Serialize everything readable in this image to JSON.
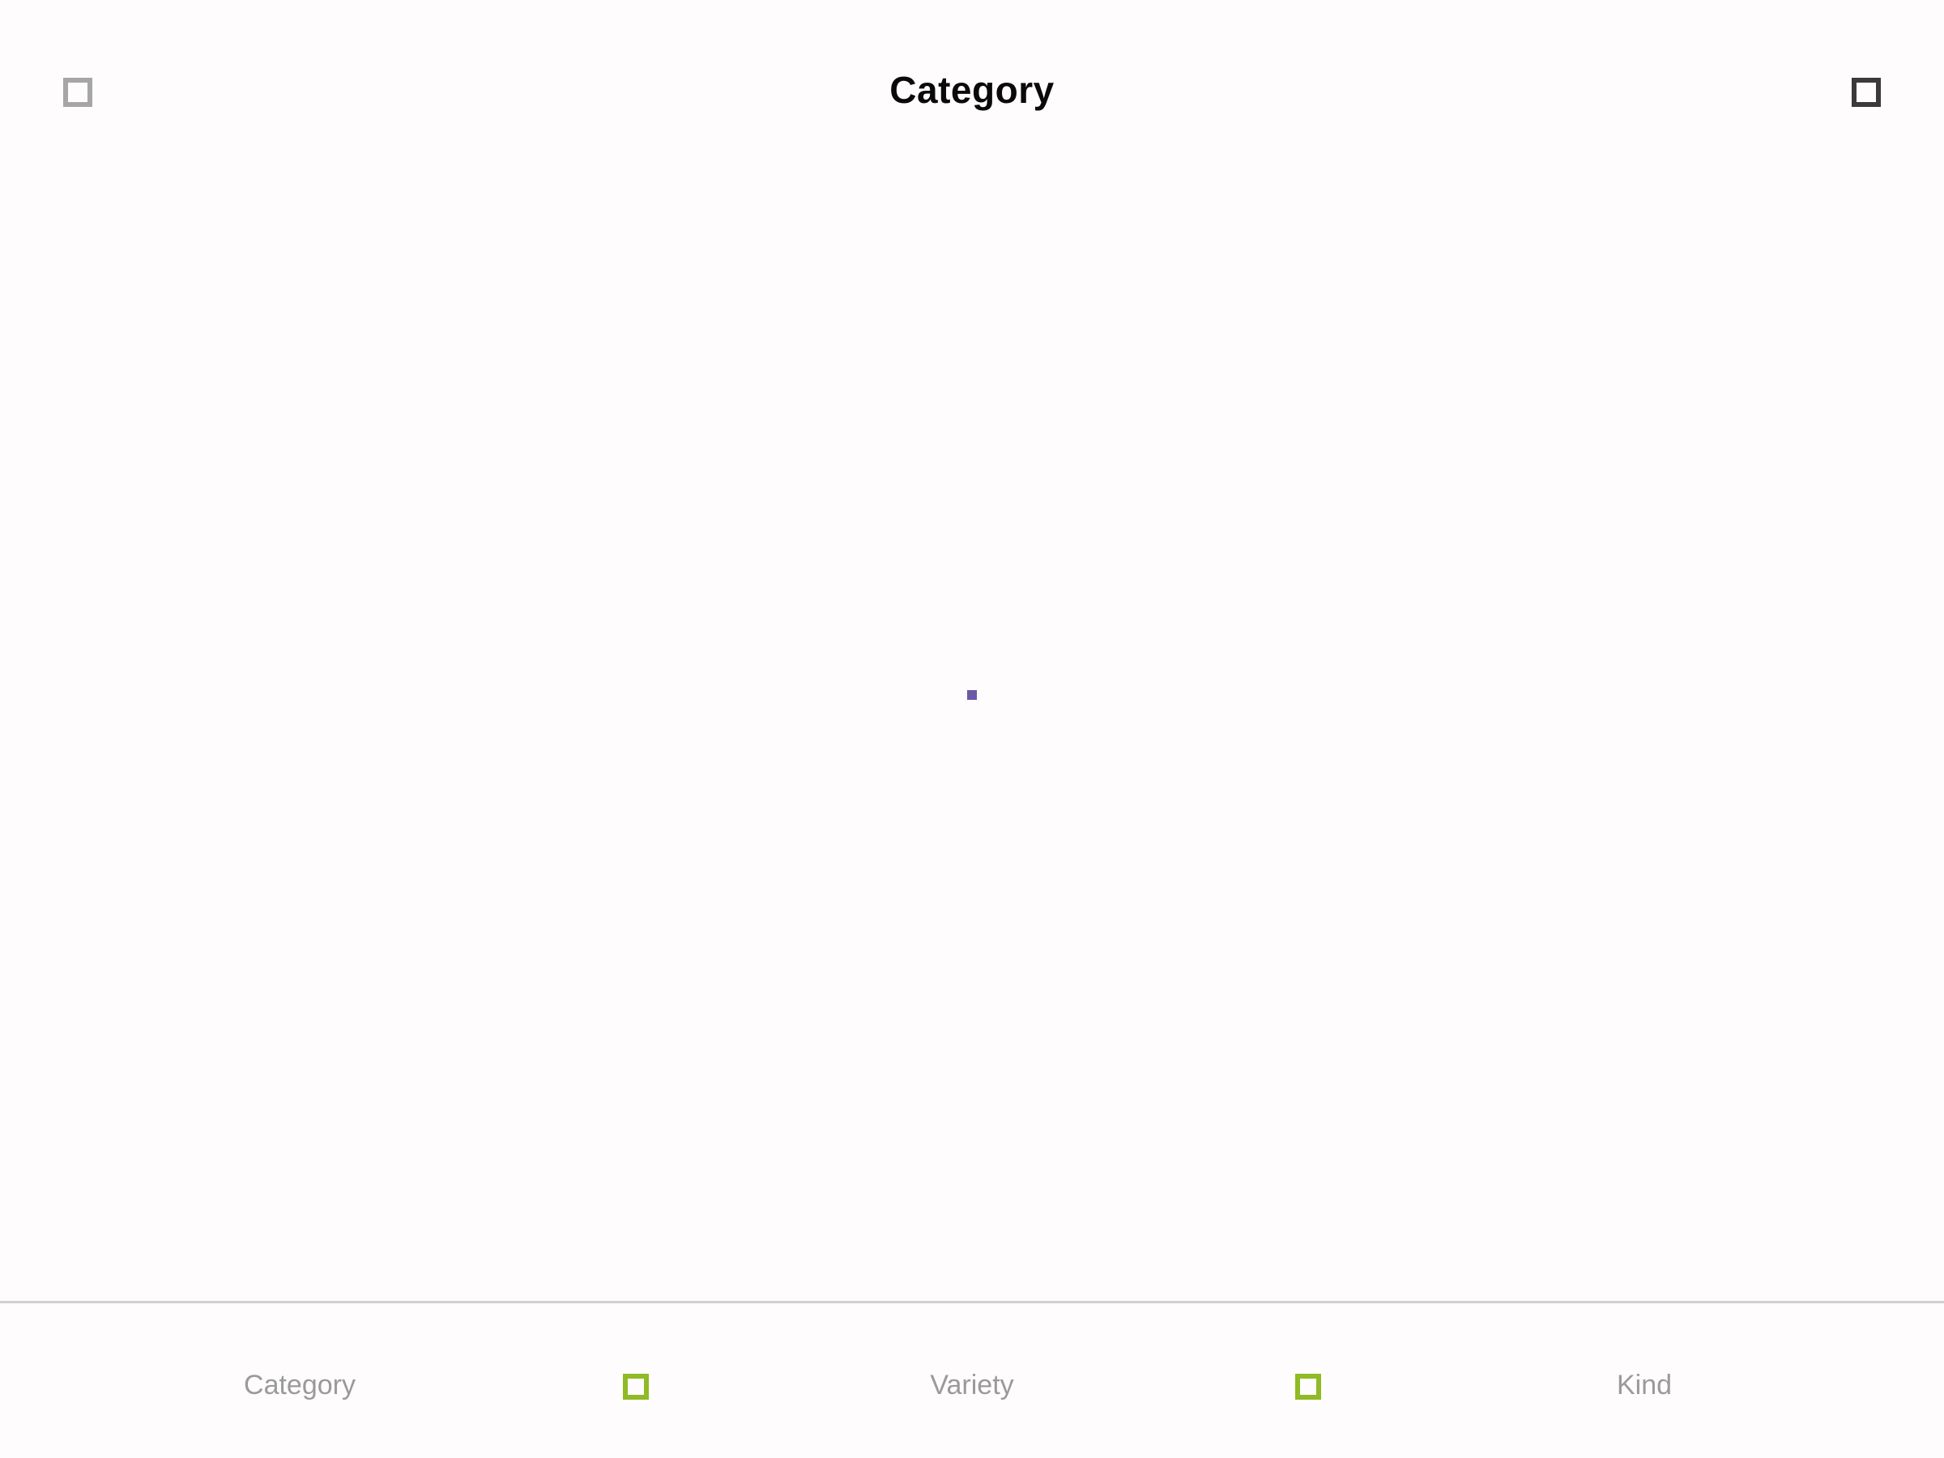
{
  "header": {
    "title": "Category",
    "left_icon": "square-outline-icon",
    "right_icon": "square-outline-icon"
  },
  "content": {
    "marker_icon": "square-dot-icon"
  },
  "bottom_nav": {
    "items": [
      {
        "label": "Category"
      },
      {
        "label": "Variety"
      },
      {
        "label": "Kind"
      }
    ],
    "separator_icon": "square-outline-icon"
  },
  "colors": {
    "background": "#fffcfd",
    "title": "#0a0a0a",
    "left_icon": "#a6a6a6",
    "right_icon": "#3a3a3a",
    "marker": "#6c58a8",
    "nav_text": "#9a9a9a",
    "separator": "#8fbb24",
    "divider": "#d0d0d0"
  }
}
